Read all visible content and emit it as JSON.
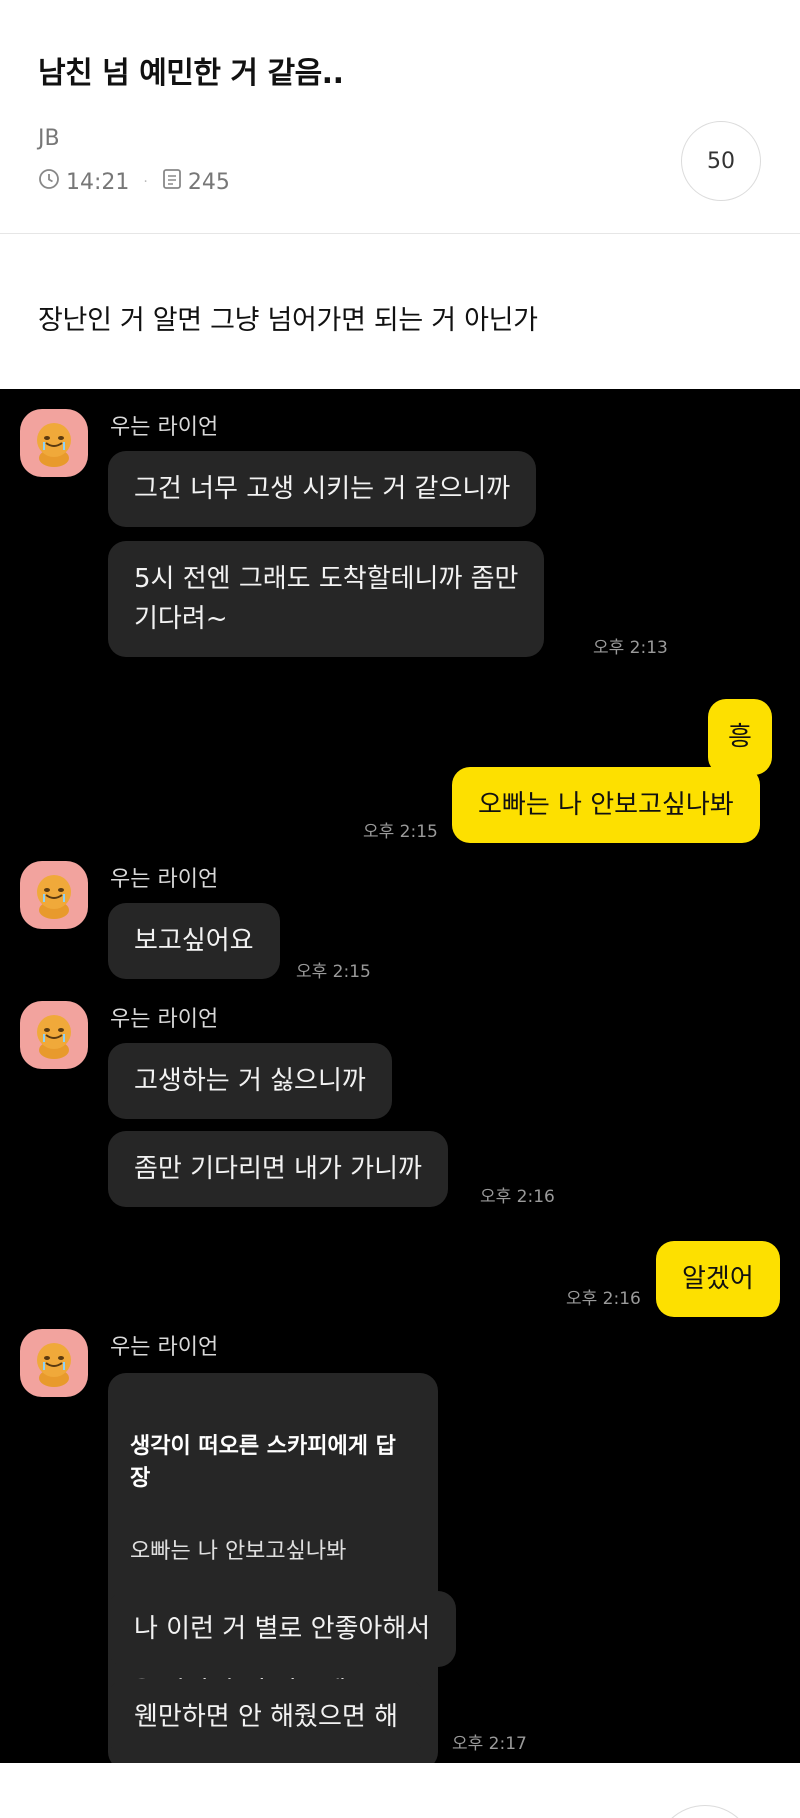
{
  "post": {
    "title": "남친 넘 예민한 거 같음..",
    "author": "JB",
    "time": "14:21",
    "views": "245",
    "comment_count": "50",
    "body": "장난인 거 알면 그냥 넘어가면 되는 거 아닌가"
  },
  "chat": {
    "sender_name": "우는 라이언",
    "messages": [
      {
        "from": "other",
        "text": "그건 너무 고생 시키는 거 같으니까"
      },
      {
        "from": "other",
        "text": "5시 전엔 그래도 도착할테니까 좀만\n기다려~",
        "time": "오후 2:13"
      },
      {
        "from": "me",
        "text": "흥"
      },
      {
        "from": "me",
        "text": "오빠는 나 안보고싶나봐",
        "time": "오후 2:15"
      },
      {
        "from": "other",
        "text": "보고싶어요",
        "time": "오후 2:15"
      },
      {
        "from": "other",
        "text": "고생하는 거 싫으니까"
      },
      {
        "from": "other",
        "text": "좀만 기다리면 내가 가니까",
        "time": "오후 2:16"
      },
      {
        "from": "me",
        "text": "알겠어",
        "time": "오후 2:16"
      },
      {
        "from": "other",
        "reply_header": "생각이 떠오른 스카피에게 답장",
        "reply_quote": "오빠는 나 안보고싶나봐",
        "text": "음 장난인 거 아는데"
      },
      {
        "from": "other",
        "text": "나 이런 거 별로 안좋아해서"
      },
      {
        "from": "other",
        "text": "웬만하면 안 해줬으면 해",
        "time": "오후 2:17"
      }
    ]
  },
  "icons": {
    "clock": "clock-icon",
    "views": "document-icon",
    "avatar": "lion-avatar-icon"
  },
  "colors": {
    "chat_bg": "#000000",
    "other_bubble": "#262626",
    "my_bubble": "#fde000",
    "avatar_bg": "#f2a39e"
  }
}
